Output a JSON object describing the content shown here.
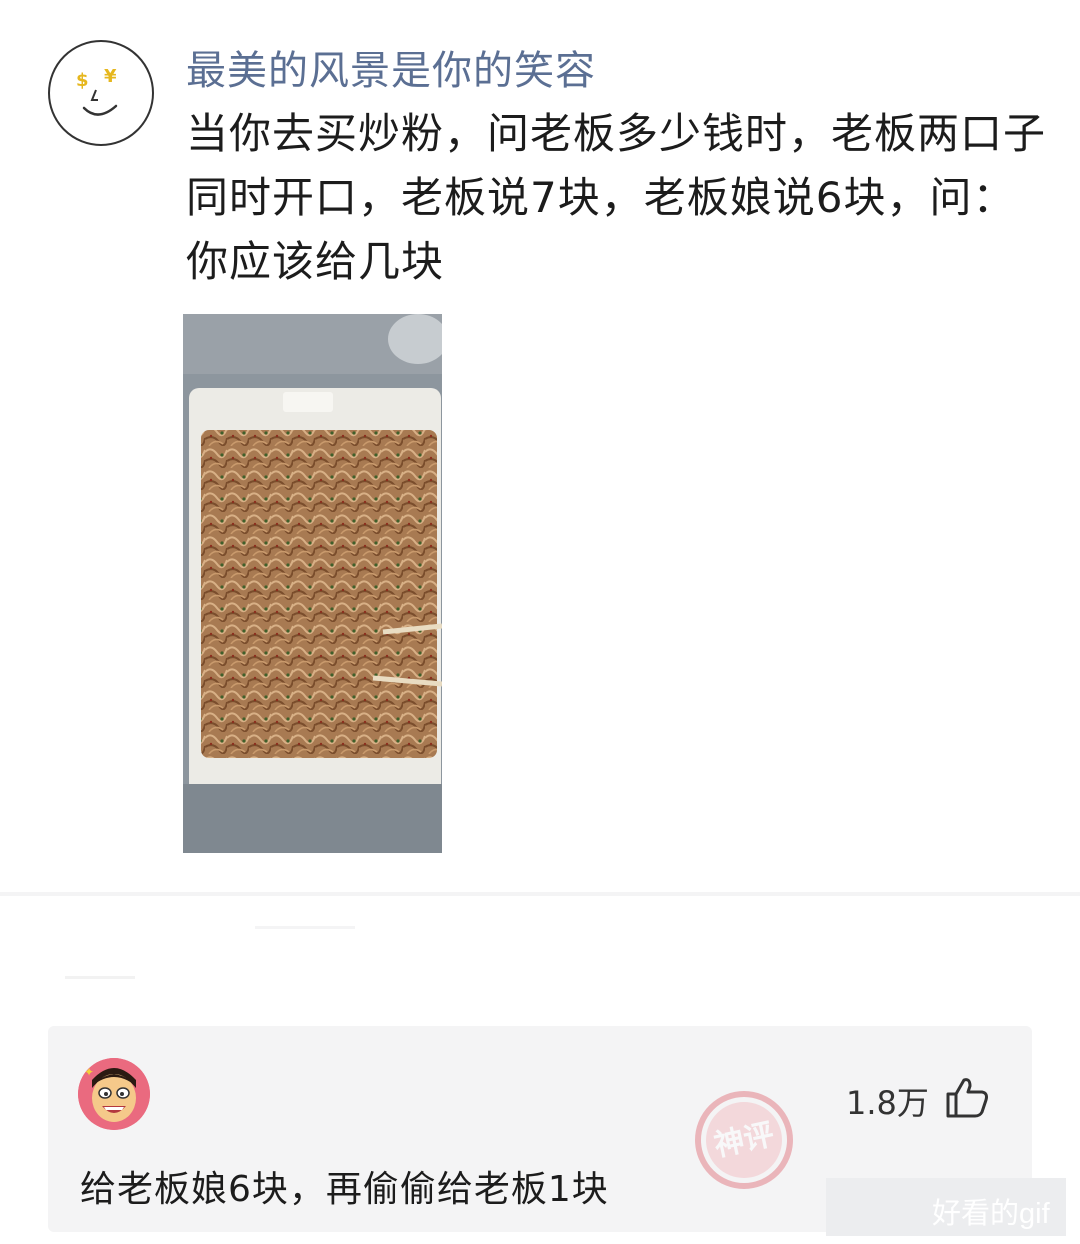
{
  "post": {
    "username": "最美的风景是你的笑容",
    "text": "当你去买炒粉，问老板多少钱时，老板两口子同时开口，老板说7块，老板娘说6块，问：你应该给几块",
    "avatar_marks": [
      "$",
      "¥"
    ],
    "icons": {
      "avatar": "smiley-face-icon"
    }
  },
  "comment": {
    "likes": "1.8万",
    "text": "给老板娘6块，再偷偷给老板1块",
    "stamp": "神评",
    "icons": {
      "like": "thumbs-up-icon",
      "avatar": "cartoon-face-icon"
    }
  },
  "watermark": "好看的gif"
}
